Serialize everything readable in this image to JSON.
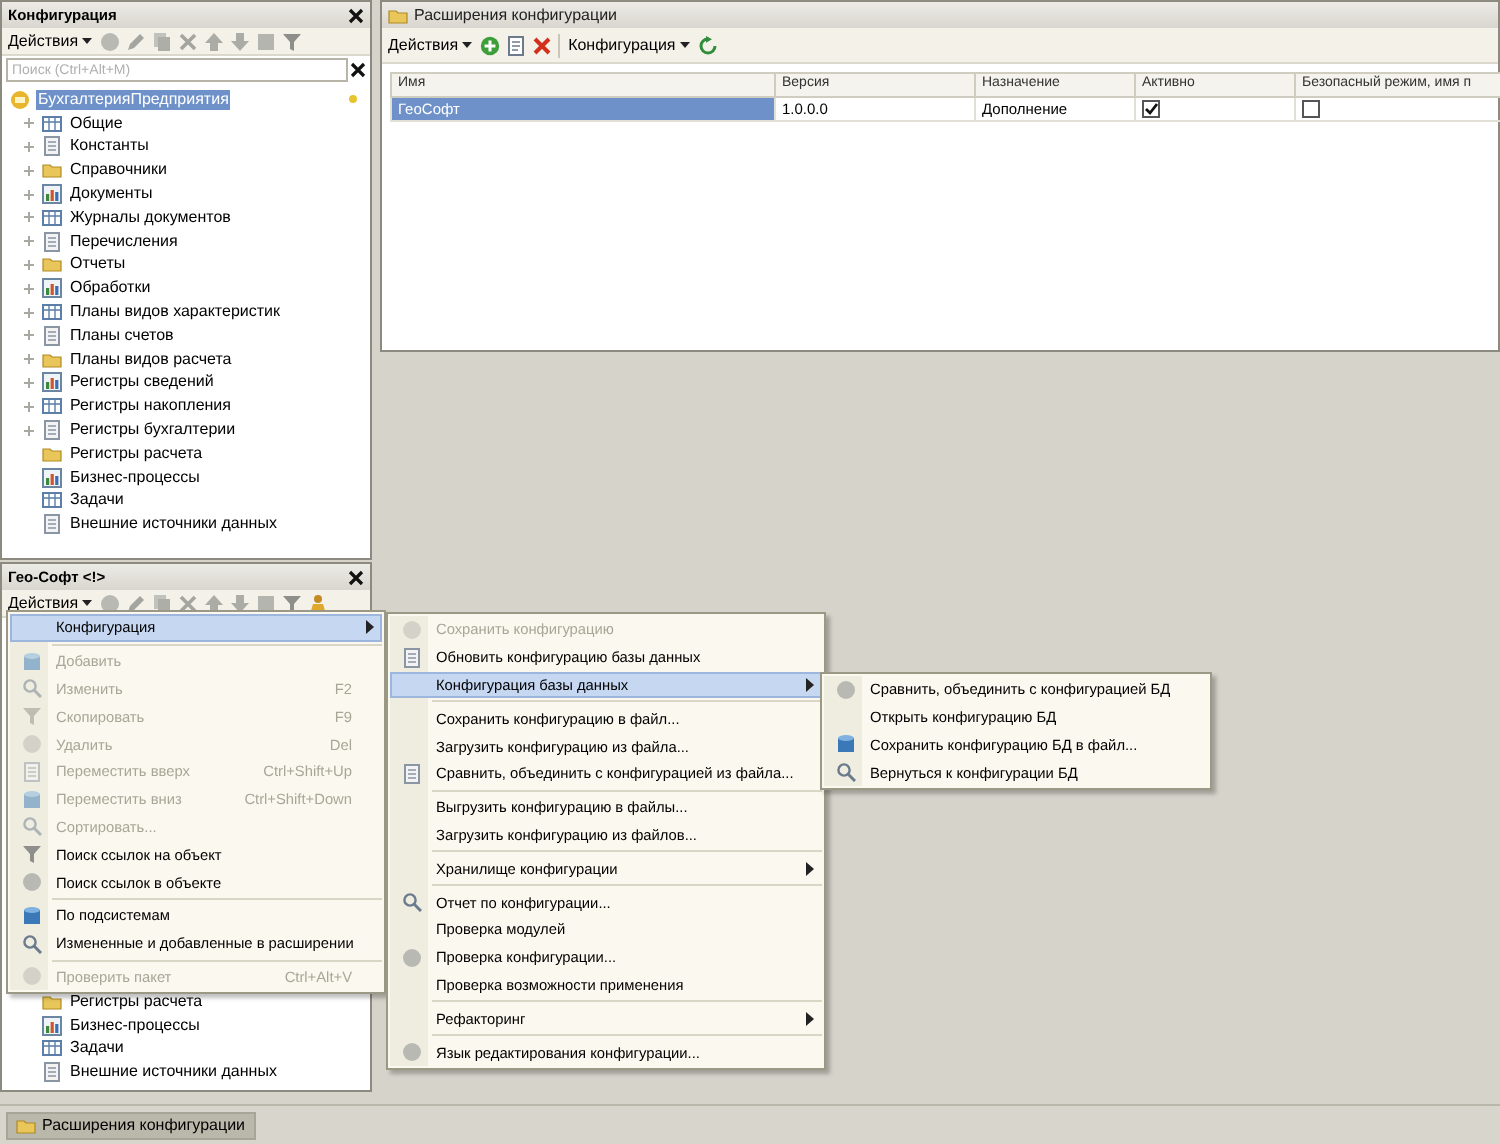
{
  "config_panel": {
    "title": "Конфигурация",
    "actions": "Действия",
    "search": {
      "placeholder": "Поиск (Ctrl+Alt+M)"
    },
    "tree": {
      "label": "БухгалтерияПредприятия",
      "selected": true,
      "children": [
        {
          "label": "Общие",
          "expandable": true
        },
        {
          "label": "Константы",
          "expandable": true
        },
        {
          "label": "Справочники",
          "expandable": true
        },
        {
          "label": "Документы",
          "expandable": true
        },
        {
          "label": "Журналы документов",
          "expandable": true
        },
        {
          "label": "Перечисления",
          "expandable": true
        },
        {
          "label": "Отчеты",
          "expandable": true
        },
        {
          "label": "Обработки",
          "expandable": true
        },
        {
          "label": "Планы видов характеристик",
          "expandable": true
        },
        {
          "label": "Планы счетов",
          "expandable": true
        },
        {
          "label": "Планы видов расчета",
          "expandable": true
        },
        {
          "label": "Регистры сведений",
          "expandable": true
        },
        {
          "label": "Регистры накопления",
          "expandable": true
        },
        {
          "label": "Регистры бухгалтерии",
          "expandable": true
        },
        {
          "label": "Регистры расчета",
          "expandable": false
        },
        {
          "label": "Бизнес-процессы",
          "expandable": false
        },
        {
          "label": "Задачи",
          "expandable": false
        },
        {
          "label": "Внешние источники данных",
          "expandable": false
        }
      ]
    }
  },
  "extension_panel": {
    "title": "Гео-Софт <!>",
    "actions": "Действия",
    "tree_items": [
      {
        "label": "Регистры расчета",
        "expandable": false
      },
      {
        "label": "Бизнес-процессы",
        "expandable": false
      },
      {
        "label": "Задачи",
        "expandable": false
      },
      {
        "label": "Внешние источники данных",
        "expandable": false
      }
    ]
  },
  "actions_menu": [
    {
      "kind": "item",
      "label": "Конфигурация",
      "highlighted": true,
      "disabled": false,
      "submenu": true,
      "has_icon": false
    },
    {
      "kind": "separator"
    },
    {
      "kind": "item",
      "label": "Добавить",
      "disabled": true,
      "has_icon": true
    },
    {
      "kind": "item",
      "label": "Изменить",
      "shortcut": "F2",
      "disabled": true,
      "has_icon": true
    },
    {
      "kind": "item",
      "label": "Скопировать",
      "shortcut": "F9",
      "disabled": true,
      "has_icon": true
    },
    {
      "kind": "item",
      "label": "Удалить",
      "shortcut": "Del",
      "disabled": true,
      "has_icon": true
    },
    {
      "kind": "item",
      "label": "Переместить вверх",
      "shortcut": "Ctrl+Shift+Up",
      "disabled": true,
      "has_icon": true
    },
    {
      "kind": "item",
      "label": "Переместить вниз",
      "shortcut": "Ctrl+Shift+Down",
      "disabled": true,
      "has_icon": true
    },
    {
      "kind": "item",
      "label": "Сортировать...",
      "disabled": true,
      "has_icon": true
    },
    {
      "kind": "item",
      "label": "Поиск ссылок на объект",
      "disabled": false,
      "has_icon": true
    },
    {
      "kind": "item",
      "label": "Поиск ссылок в объекте",
      "disabled": false,
      "has_icon": true
    },
    {
      "kind": "separator"
    },
    {
      "kind": "item",
      "label": "По подсистемам",
      "disabled": false,
      "has_icon": true
    },
    {
      "kind": "item",
      "label": "Измененные и добавленные в расширении",
      "disabled": false,
      "has_icon": true
    },
    {
      "kind": "separator"
    },
    {
      "kind": "item",
      "label": "Проверить пакет",
      "shortcut": "Ctrl+Alt+V",
      "disabled": true,
      "has_icon": true
    }
  ],
  "configuration_submenu": [
    {
      "kind": "item",
      "label": "Сохранить конфигурацию",
      "disabled": true,
      "has_icon": true
    },
    {
      "kind": "item",
      "label": "Обновить конфигурацию базы данных",
      "disabled": false,
      "has_icon": true
    },
    {
      "kind": "item",
      "label": "Конфигурация базы данных",
      "highlighted": true,
      "disabled": false,
      "submenu": true,
      "has_icon": false
    },
    {
      "kind": "separator"
    },
    {
      "kind": "item",
      "label": "Сохранить конфигурацию в файл...",
      "disabled": false,
      "has_icon": false
    },
    {
      "kind": "item",
      "label": "Загрузить конфигурацию из файла...",
      "disabled": false,
      "has_icon": false
    },
    {
      "kind": "item",
      "label": "Сравнить, объединить с конфигурацией из файла...",
      "disabled": false,
      "has_icon": true
    },
    {
      "kind": "separator"
    },
    {
      "kind": "item",
      "label": "Выгрузить конфигурацию в файлы...",
      "disabled": false,
      "has_icon": false
    },
    {
      "kind": "item",
      "label": "Загрузить конфигурацию из файлов...",
      "disabled": false,
      "has_icon": false
    },
    {
      "kind": "separator"
    },
    {
      "kind": "item",
      "label": "Хранилище конфигурации",
      "disabled": false,
      "submenu": true,
      "has_icon": false
    },
    {
      "kind": "separator"
    },
    {
      "kind": "item",
      "label": "Отчет по конфигурации...",
      "disabled": false,
      "has_icon": true
    },
    {
      "kind": "item",
      "label": "Проверка модулей",
      "disabled": false,
      "has_icon": false
    },
    {
      "kind": "item",
      "label": "Проверка конфигурации...",
      "disabled": false,
      "has_icon": true
    },
    {
      "kind": "item",
      "label": "Проверка возможности применения",
      "disabled": false,
      "has_icon": false
    },
    {
      "kind": "separator"
    },
    {
      "kind": "item",
      "label": "Рефакторинг",
      "disabled": false,
      "submenu": true,
      "has_icon": false
    },
    {
      "kind": "separator"
    },
    {
      "kind": "item",
      "label": "Язык редактирования конфигурации...",
      "disabled": false,
      "has_icon": true
    }
  ],
  "database_submenu": [
    {
      "kind": "item",
      "label": "Сравнить, объединить с конфигурацией БД",
      "disabled": false,
      "has_icon": true
    },
    {
      "kind": "item",
      "label": "Открыть конфигурацию БД",
      "disabled": false,
      "has_icon": false
    },
    {
      "kind": "item",
      "label": "Сохранить конфигурацию БД в файл...",
      "disabled": false,
      "has_icon": true
    },
    {
      "kind": "item",
      "label": "Вернуться к конфигурации БД",
      "disabled": false,
      "has_icon": true
    }
  ],
  "extensions_window": {
    "title": "Расширения конфигурации",
    "toolbar": {
      "actions": "Действия",
      "configuration": "Конфигурация"
    },
    "table": {
      "columns": [
        "Имя",
        "Версия",
        "Назначение",
        "Активно",
        "Безопасный режим, имя п"
      ],
      "rows": [
        {
          "name": "ГеоСофт",
          "version": "1.0.0.0",
          "purpose": "Дополнение",
          "active": true,
          "safe_mode": false,
          "selected": true
        }
      ]
    }
  },
  "taskbar": [
    {
      "label": "Расширения конфигурации",
      "selected": true
    }
  ]
}
